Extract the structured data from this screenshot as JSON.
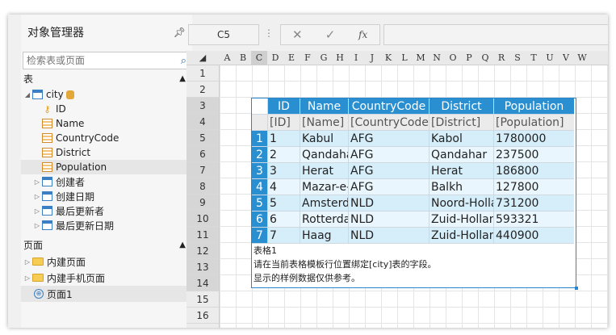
{
  "panel": {
    "title": "对象管理器",
    "search_placeholder": "检索表或页面",
    "tables_label": "表",
    "table_name": "city",
    "fields": [
      "ID",
      "Name",
      "CountryCode",
      "District",
      "Population"
    ],
    "meta_fields": [
      "创建者",
      "创建日期",
      "最后更新者",
      "最后更新日期"
    ],
    "pages_label": "页面",
    "pages": [
      "内建页面",
      "内建手机页面"
    ],
    "current_page": "页面1"
  },
  "formula_bar": {
    "cell_ref": "C5",
    "fx_label": "fx"
  },
  "sheet": {
    "columns": [
      "A",
      "B",
      "C",
      "D",
      "E",
      "F",
      "G",
      "H",
      "I",
      "J",
      "K",
      "L",
      "M",
      "N",
      "O",
      "P",
      "Q",
      "R",
      "S",
      "T",
      "U",
      "V",
      "W"
    ],
    "rows": [
      "1",
      "2",
      "3",
      "4",
      "5",
      "6",
      "7",
      "8",
      "9",
      "10",
      "11",
      "12",
      "13",
      "14",
      "15",
      "16"
    ],
    "table": {
      "headers": [
        "ID",
        "Name",
        "CountryCode",
        "District",
        "Population"
      ],
      "bindings": [
        "[ID]",
        "[Name]",
        "[CountryCode]",
        "[District]",
        "[Population]"
      ],
      "rows": [
        {
          "n": "1",
          "id": "1",
          "name": "Kabul",
          "code": "AFG",
          "district": "Kabol",
          "population": "1780000"
        },
        {
          "n": "2",
          "id": "2",
          "name": "Qandahar",
          "code": "AFG",
          "district": "Qandahar",
          "population": "237500"
        },
        {
          "n": "3",
          "id": "3",
          "name": "Herat",
          "code": "AFG",
          "district": "Herat",
          "population": "186800"
        },
        {
          "n": "4",
          "id": "4",
          "name": "Mazar-e-Sharif",
          "code": "AFG",
          "district": "Balkh",
          "population": "127800"
        },
        {
          "n": "5",
          "id": "5",
          "name": "Amsterdam",
          "code": "NLD",
          "district": "Noord-Holland",
          "population": "731200"
        },
        {
          "n": "6",
          "id": "6",
          "name": "Rotterdam",
          "code": "NLD",
          "district": "Zuid-Holland",
          "population": "593321"
        },
        {
          "n": "7",
          "id": "7",
          "name": "Haag",
          "code": "NLD",
          "district": "Zuid-Holland",
          "population": "440900"
        }
      ],
      "note_title": "表格1",
      "note_line1": "请在当前表格模板行位置绑定[city]表的字段。",
      "note_line2": "显示的样例数据仅供参考。"
    }
  }
}
